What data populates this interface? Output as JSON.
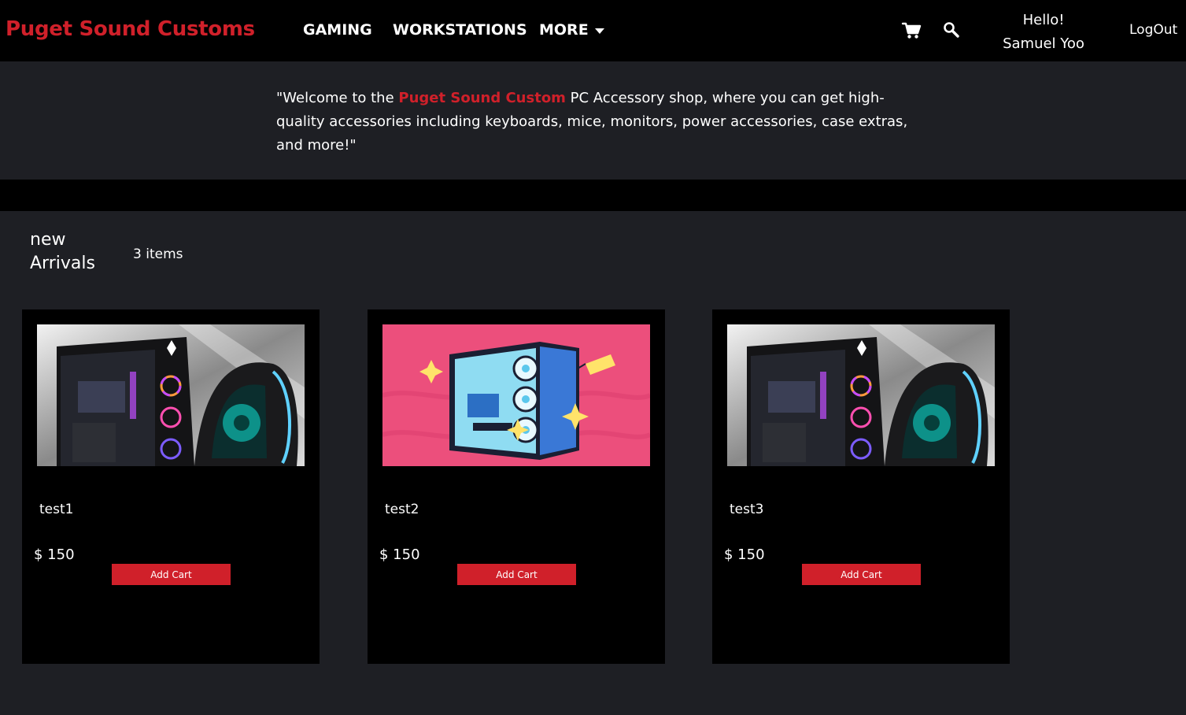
{
  "header": {
    "brand": "Puget Sound Customs",
    "nav": {
      "gaming": "GAMING",
      "workstations": "WORKSTATIONS",
      "more": "MORE"
    },
    "icons": {
      "cart": "cart-icon",
      "search": "search-icon"
    },
    "greeting_line1": "Hello!",
    "greeting_line2": "Samuel Yoo",
    "logout": "LogOut"
  },
  "welcome": {
    "before": "\"Welcome to the ",
    "highlight": "Puget Sound Custom",
    "after": " PC Accessory shop, where you can get high-quality accessories including keyboards, mice, monitors, power accessories, case extras, and more!\""
  },
  "section": {
    "title_line1": "new",
    "title_line2": "Arrivals",
    "count": "3 items"
  },
  "products": [
    {
      "name": "test1",
      "price": "$ 150",
      "button": "Add Cart"
    },
    {
      "name": "test2",
      "price": "$ 150",
      "button": "Add Cart"
    },
    {
      "name": "test3",
      "price": "$ 150",
      "button": "Add Cart"
    }
  ],
  "colors": {
    "accent": "#d0202a",
    "page_bg": "#1e1f24",
    "navbar_bg": "#000000",
    "card_bg": "#000000"
  }
}
